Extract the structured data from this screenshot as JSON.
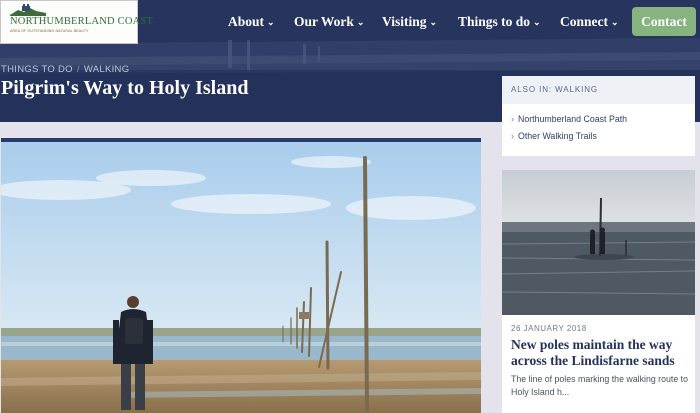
{
  "logo": {
    "name": "NORTHUMBERLAND COAST",
    "tagline": "AREA OF OUTSTANDING NATURAL BEAUTY"
  },
  "nav": {
    "items": [
      {
        "label": "About"
      },
      {
        "label": "Our Work"
      },
      {
        "label": "Visiting"
      },
      {
        "label": "Things to do"
      },
      {
        "label": "Connect"
      }
    ],
    "contact_label": "Contact"
  },
  "breadcrumb": {
    "section": "THINGS TO DO",
    "separator": "/",
    "subsection": "WALKING"
  },
  "page": {
    "title": "Pilgrim's Way to Holy Island"
  },
  "sidebar": {
    "also_in": {
      "heading": "ALSO IN: WALKING",
      "links": [
        {
          "label": "Northumberland Coast Path"
        },
        {
          "label": "Other Walking Trails"
        }
      ]
    },
    "news": {
      "date": "26 JANUARY 2018",
      "title": "New poles maintain the way across the Lindisfarne sands",
      "excerpt": "The line of poles marking the walking route to Holy Island h..."
    }
  },
  "icons": {
    "nav_caret": "chevron-down-icon",
    "link_chevron": "chevron-right-icon"
  },
  "colors": {
    "header_navy": "#24325c",
    "contact_green": "#86b37f",
    "title_navy": "#25325c",
    "page_background": "#e4e2ea"
  }
}
